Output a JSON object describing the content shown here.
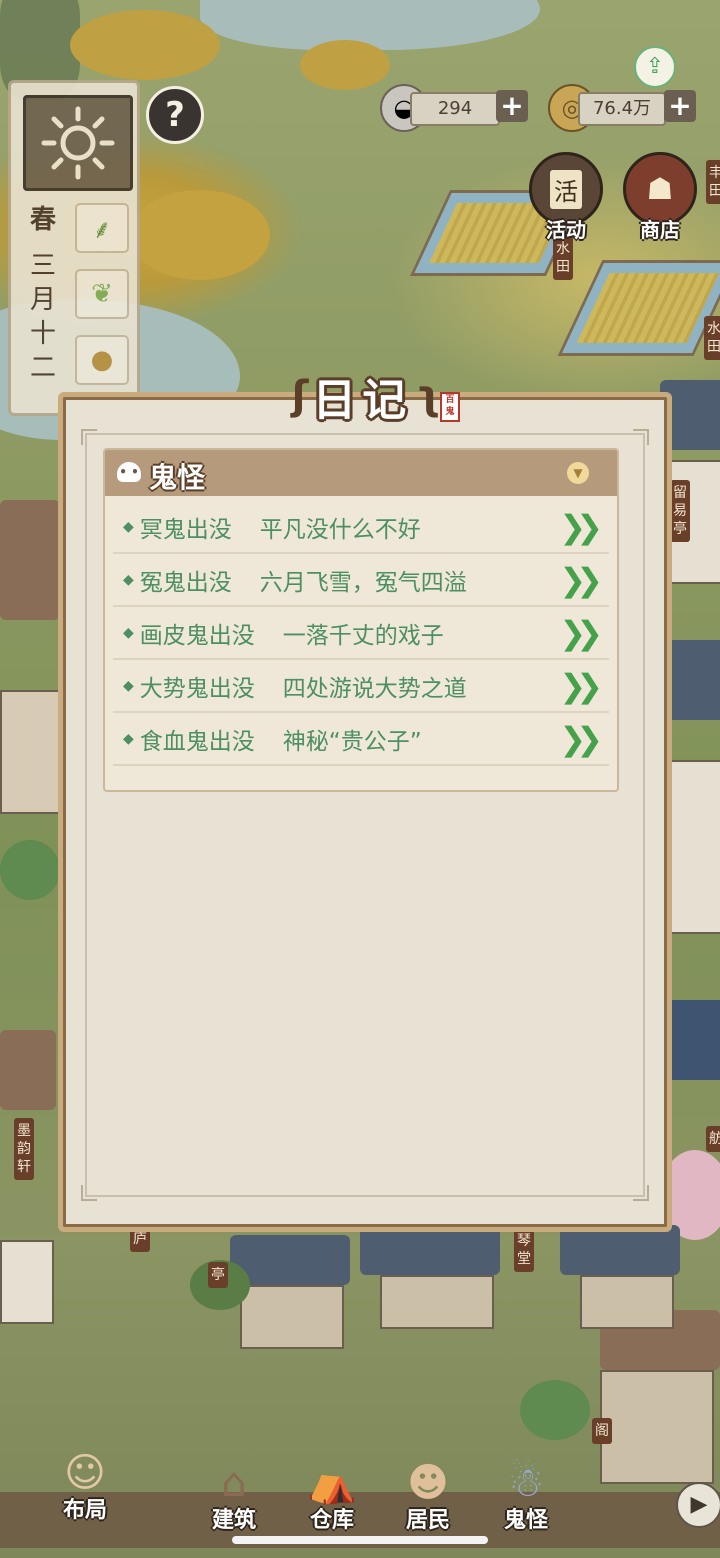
{
  "hud": {
    "season": "春",
    "date_chars": [
      "三",
      "月",
      "十",
      "二"
    ],
    "help_label": "?",
    "bowl_value": "294",
    "coin_value": "76.4万",
    "plus_label": "+",
    "activity_label": "活动",
    "activity_icon_text": "活",
    "shop_label": "商店"
  },
  "map_signs": [
    "水田",
    "水田",
    "留易亭",
    "墨韵轩",
    "琴堂",
    "庐",
    "亭",
    "阁",
    "舫",
    "丰田"
  ],
  "diary": {
    "title": "日记",
    "seal_text": "百鬼",
    "section_title": "鬼怪",
    "items": [
      {
        "name": "冥鬼出没",
        "desc": "平凡没什么不好"
      },
      {
        "name": "冤鬼出没",
        "desc": "六月飞雪，冤气四溢"
      },
      {
        "name": "画皮鬼出没",
        "desc": "一落千丈的戏子"
      },
      {
        "name": "大势鬼出没",
        "desc": "四处游说大势之道"
      },
      {
        "name": "食血鬼出没",
        "desc": "神秘“贵公子”"
      }
    ]
  },
  "nav": {
    "layout": "布局",
    "build": "建筑",
    "warehouse": "仓库",
    "residents": "居民",
    "ghosts": "鬼怪"
  },
  "colors": {
    "accent_green": "#4d8f62",
    "header_brown": "#b69a7c",
    "panel_bg": "#e8e2d5"
  }
}
